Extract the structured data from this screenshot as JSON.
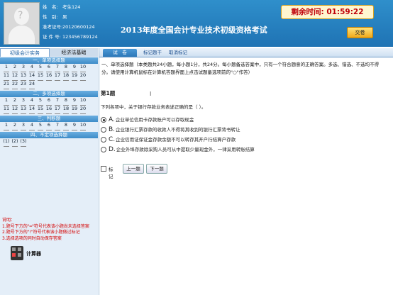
{
  "header": {
    "candidate_name_label": "姓　名:",
    "candidate_name": "考生124",
    "gender_label": "性　别:",
    "gender": "男",
    "exam_no_label": "准考证号:",
    "exam_no": "20120600124",
    "id_label": "证 件 号:",
    "id_no": "123456789124",
    "title": "2013年度全国会计专业技术初级资格考试",
    "timer_label": "剩余时间:",
    "timer_value": "01:59:22",
    "submit_label": "交卷"
  },
  "left_tabs": [
    "初级会计实务",
    "经济法基础"
  ],
  "sections": [
    {
      "title": "一、单项选择题",
      "rows": [
        [
          "1",
          "2",
          "3",
          "4",
          "5",
          "6",
          "7",
          "8",
          "9",
          "10"
        ],
        [
          "11",
          "12",
          "13",
          "14",
          "15",
          "16",
          "17",
          "18",
          "19",
          "20"
        ],
        [
          "21",
          "22",
          "23",
          "24"
        ]
      ]
    },
    {
      "title": "二、多项选择题",
      "rows": [
        [
          "1",
          "2",
          "3",
          "4",
          "5",
          "6",
          "7",
          "8",
          "9",
          "10"
        ],
        [
          "11",
          "12",
          "13",
          "14",
          "15",
          "16",
          "17",
          "18",
          "19",
          "20"
        ]
      ]
    },
    {
      "title": "三、判断题",
      "rows": [
        [
          "1",
          "2",
          "3",
          "4",
          "5",
          "6",
          "7",
          "8",
          "9",
          "10"
        ]
      ]
    },
    {
      "title": "四、不定项选择题",
      "rows": [
        [
          "(1)",
          "(2)",
          "(3)"
        ]
      ]
    }
  ],
  "notes": [
    "说明：",
    "1.题号下方的\"━\"符号代表该小题尚未选择答案",
    "2.题号下方的\"!\"符号代表该小题做过标记",
    "3.选择选项的同时自动保存答案"
  ],
  "calculator_label": "计算器",
  "main_tabs": [
    "试　卷",
    "标记题干",
    "取消标记"
  ],
  "instructions": "一、单项选择题（本类题共24小题，每小题1分，共24分。每小题备选答案中，只有一个符合题意的正确答案。多选、错选、不选均不得分。请使用计算机鼠标在计算机答题界面上点击试题备选项前的\"○\"作答）",
  "question": {
    "number": "第1题",
    "stem": "下列各项中，关于银行存款业务表述正确的是（   ）。",
    "options": [
      {
        "letter": "A.",
        "text": "企业单位信用卡存款账户可以存取现金",
        "selected": true
      },
      {
        "letter": "B.",
        "text": "企业银行汇票存款的收款人不得将其收到的银行汇票背书转让",
        "selected": false
      },
      {
        "letter": "C.",
        "text": "企业信用证保证金存款余额不可以转存其开户行结算户存款",
        "selected": false
      },
      {
        "letter": "D.",
        "text": "企业外埠存款除采购人员可从中提取少量现金外，一律采用转账结算",
        "selected": false
      }
    ]
  },
  "controls": {
    "mark_label": "标记",
    "prev_label": "上一题",
    "next_label": "下一题"
  }
}
